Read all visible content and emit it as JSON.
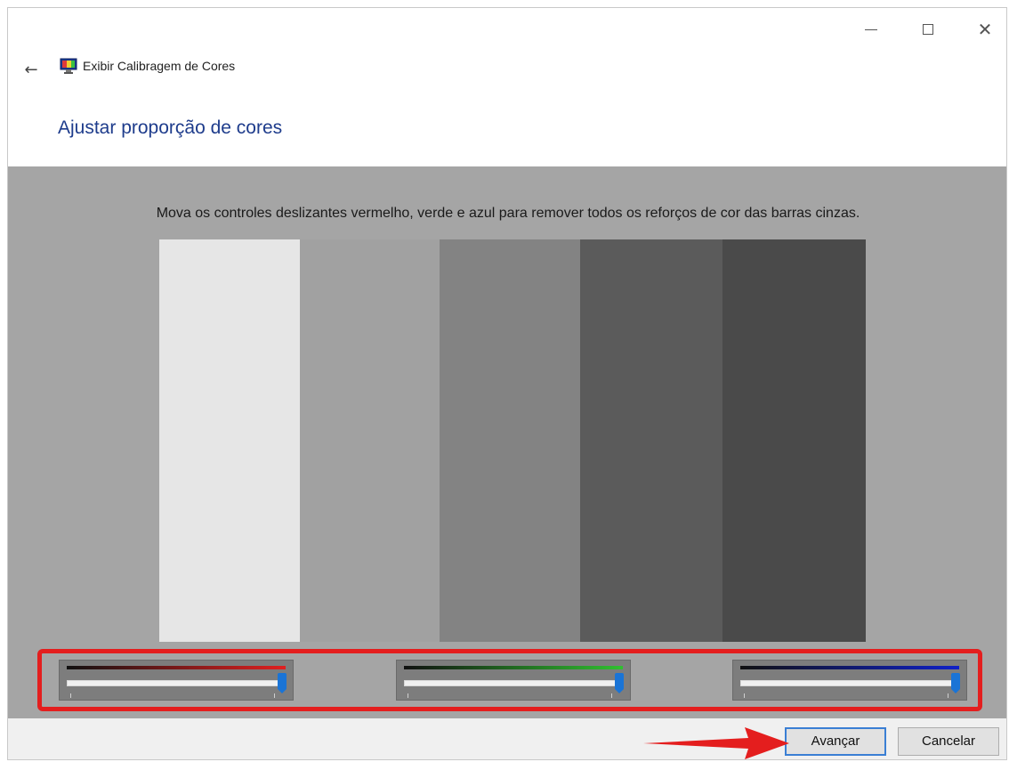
{
  "window": {
    "title": "Exibir Calibragem de Cores",
    "controls": [
      "minimize",
      "maximize",
      "close"
    ]
  },
  "nav": {
    "back_icon": "back-arrow-icon"
  },
  "page": {
    "heading": "Ajustar proporção de cores",
    "instruction": "Mova os controles deslizantes vermelho, verde e azul para remover todos os reforços de cor das barras cinzas."
  },
  "gray_bars": [
    "#e6e6e6",
    "#a1a1a1",
    "#838383",
    "#5b5b5b",
    "#4a4a4a"
  ],
  "sliders": [
    {
      "name": "red",
      "color": "#e02020",
      "value": 1.0
    },
    {
      "name": "green",
      "color": "#30c030",
      "value": 1.0
    },
    {
      "name": "blue",
      "color": "#1020c8",
      "value": 1.0
    }
  ],
  "buttons": {
    "next_label": "Avançar",
    "cancel_label": "Cancelar"
  },
  "colors": {
    "accent": "#1e3c8c",
    "highlight": "#e41e1e",
    "thumb": "#1a74d6"
  }
}
